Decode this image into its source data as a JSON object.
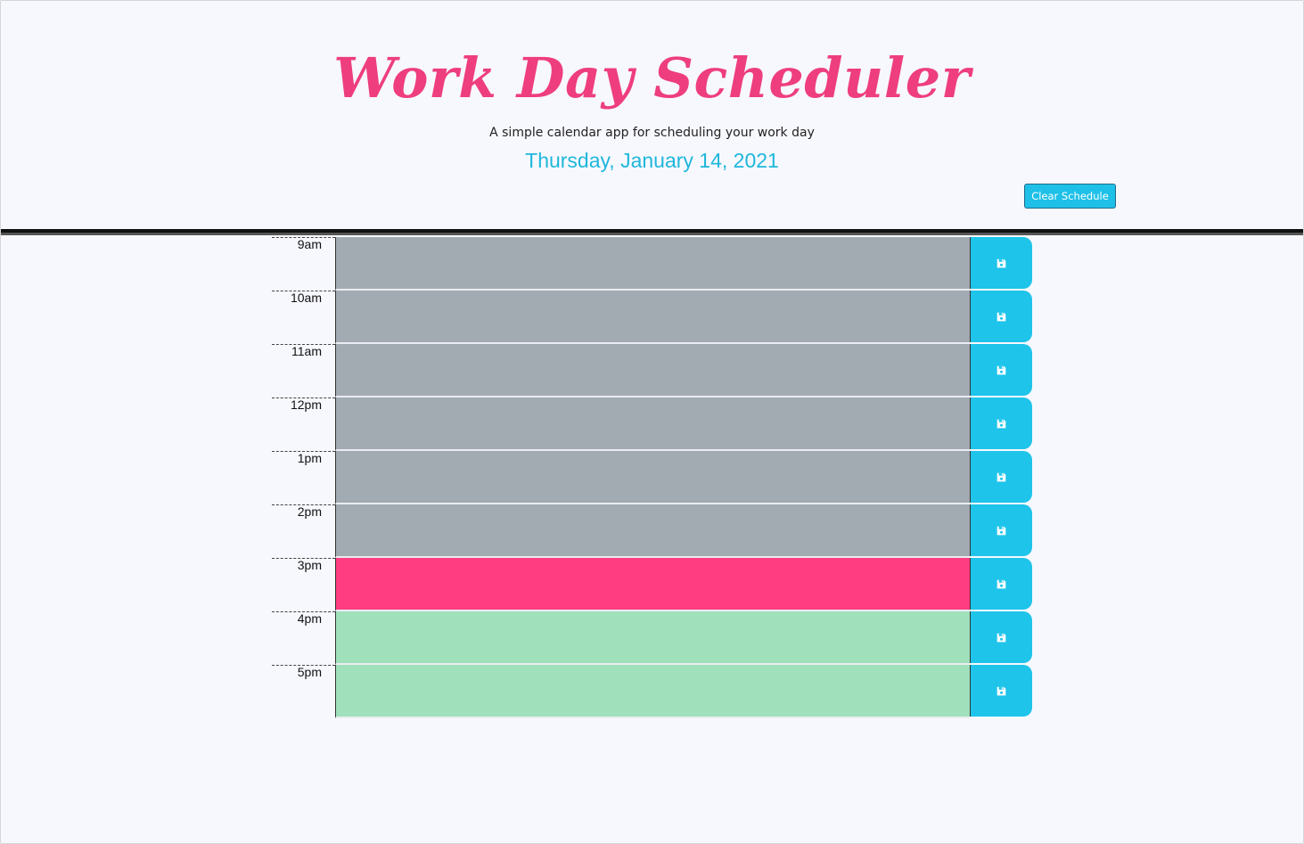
{
  "header": {
    "title": "Work Day Scheduler",
    "subtitle": "A simple calendar app for scheduling your work day",
    "current_day": "Thursday, January 14, 2021",
    "clear_label": "Clear Schedule"
  },
  "colors": {
    "title": "#ee3e7e",
    "date": "#1fb7db",
    "past": "#a2abb2",
    "present": "#ff3d80",
    "future": "#a0e0bb",
    "save": "#1ec4ea"
  },
  "schedule": {
    "blocks": [
      {
        "hour": "9am",
        "state": "past",
        "text": "",
        "save_icon": "floppy-disk-icon"
      },
      {
        "hour": "10am",
        "state": "past",
        "text": "",
        "save_icon": "floppy-disk-icon"
      },
      {
        "hour": "11am",
        "state": "past",
        "text": "",
        "save_icon": "floppy-disk-icon"
      },
      {
        "hour": "12pm",
        "state": "past",
        "text": "",
        "save_icon": "floppy-disk-icon"
      },
      {
        "hour": "1pm",
        "state": "past",
        "text": "",
        "save_icon": "floppy-disk-icon"
      },
      {
        "hour": "2pm",
        "state": "past",
        "text": "",
        "save_icon": "floppy-disk-icon"
      },
      {
        "hour": "3pm",
        "state": "present",
        "text": "",
        "save_icon": "floppy-disk-icon"
      },
      {
        "hour": "4pm",
        "state": "future",
        "text": "",
        "save_icon": "floppy-disk-icon"
      },
      {
        "hour": "5pm",
        "state": "future",
        "text": "",
        "save_icon": "floppy-disk-icon"
      }
    ]
  }
}
